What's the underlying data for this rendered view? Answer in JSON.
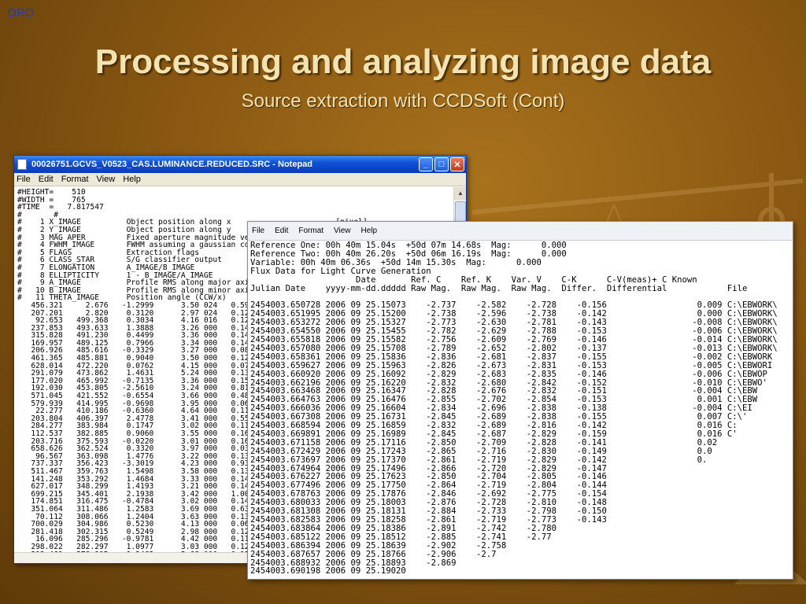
{
  "slide": {
    "corner_label": "DRO",
    "title": "Processing and analyzing image data",
    "subtitle": "Source extraction with CCDSoft (Cont)"
  },
  "notepad": {
    "title": "00026751.GCVS_V0523_CAS.LUMINANCE.REDUCED.SRC - Notepad",
    "menu": [
      "File",
      "Edit",
      "Format",
      "View",
      "Help"
    ],
    "buttons": {
      "minimize": "_",
      "maximize": "□",
      "close": "✕"
    },
    "lines": [
      "#HEIGHT=    510",
      "#WIDTH =    765",
      "#TIME  =   7.817547",
      "#       #",
      "#    1 X_IMAGE          Object position along x                       [pixel]",
      "#    2 Y_IMAGE          Object position along y",
      "#    3 MAG_APER         Fixed aperture magnitude vec",
      "#    4 FWHM_IMAGE       FWHM assuming a gaussian cor",
      "#    5 FLAGS            Extraction flags",
      "#    6 CLASS_STAR       S/G classifier output",
      "#    7 ELONGATION       A_IMAGE/B_IMAGE",
      "#    8 ELLIPTICITY      1 - B_IMAGE/A_IMAGE",
      "#    9 A_IMAGE          Profile RMS along major axis",
      "#   10 B_IMAGE          Profile RMS along minor axis",
      "#   11 THETA_IMAGE      Position angle (CCW/x)",
      "   456.321     2.676   -1.2999      3.50 024   0.59",
      "   207.201     2.820    0.3120      2.97 024   0.12",
      "    92.653   499.368    0.3034      4.16 016   0.12",
      "   237.853   493.633    1.3888      3.26 000   0.14",
      "   315.828   491.230    0.4499      3.36 000   0.14",
      "   169.957   489.125    0.7966      3.34 000   0.14",
      "   206.926   485.616   -0.3329      3.27 000   0.08",
      "   461.365   485.881    0.9040      3.50 000   0.12",
      "   628.014   472.220    0.0762      4.15 000   0.07",
      "   291.079   473.862    1.4631      5.24 000   0.13",
      "   177.020   465.992   -0.7135      3.36 000   0.15",
      "   192.030   453.805   -2.5610      3.24 000   0.81",
      "   571.045   421.552   -0.6554      3.66 000   0.48",
      "   579.939   414.995   -0.9698      3.95 000   0.06",
      "    22.277   410.186   -0.6360      4.64 000   0.11",
      "   203.804   406.397    2.4778      3.41 000   0.55",
      "   284.277   383.984    0.1747      3.02 000   0.11",
      "   112.537   382.885    0.9060      3.55 000   0.16",
      "   203.716   375.593   -0.0220      3.01 000   0.16",
      "   658.626   362.524    0.3320      3.97 000   0.03",
      "    96.567   363.098    1.4776      3.22 000   0.13",
      "   737.337   356.423   -3.3019      4.23 000   0.93",
      "   511.467   359.763    1.5498      3.58 000   0.13",
      "   141.248   353.292    1.4684      3.33 000   0.14",
      "   627.017   348.299    1.4193      3.21 000   0.14",
      "   699.215   345.401    2.1938      3.42 000   1.00",
      "   174.851   316.475   -0.4784      3.02 000   0.14",
      "   351.064   311.486    1.2583      3.69 000   0.63",
      "    70.112   308.066    1.2404      3.63 000   0.13",
      "   700.029   304.986    0.5230      4.13 000   0.06",
      "   281.418   302.315    0.5249      2.98 000   0.12",
      "    16.096   285.296   -0.9781      4.42 000   0.11",
      "   298.022   282.297    1.0977      3.03 000   0.12",
      "   313.461   278.995    1.3463      2.68 000   0.12"
    ]
  },
  "lightcurve": {
    "menu": [
      "File",
      "Edit",
      "Format",
      "View",
      "Help"
    ],
    "lines": [
      "Reference One: 00h 40m 15.04s  +50d 07m 14.68s  Mag:      0.000",
      "Reference Two: 00h 40m 26.20s  +50d 06m 16.19s  Mag:      0.000",
      "Variable: 00h 40m 06.36s  +50d 14m 15.30s  Mag:      0.000",
      "Flux Data for Light Curve Generation",
      "                     Date       Ref. C    Ref. K    Var. V    C-K      C-V(meas)+ C Known",
      "Julian Date    yyyy-mm-dd.ddddd Raw Mag.  Raw Mag.  Raw Mag.  Differ.  Differential            File",
      "",
      "2454003.650728 2006 09 25.15073    -2.737    -2.582    -2.728    -0.156                  0.009 C:\\EBWORK\\",
      "2454003.651995 2006 09 25.15200    -2.738    -2.596    -2.738    -0.142                  0.000 C:\\EBWORK\\",
      "2454003.653272 2006 09 25.15327    -2.773    -2.630    -2.781    -0.143                 -0.008 C:\\EBWORK\\",
      "2454003.654550 2006 09 25.15455    -2.782    -2.629    -2.788    -0.153                 -0.006 C:\\EBWORK\\",
      "2454003.655818 2006 09 25.15582    -2.756    -2.609    -2.769    -0.146                 -0.014 C:\\EBWORK\\",
      "2454003.657080 2006 09 25.15708    -2.789    -2.652    -2.802    -0.137                 -0.013 C:\\EBWORK\\",
      "2454003.658361 2006 09 25.15836    -2.836    -2.681    -2.837    -0.155                 -0.002 C:\\EBWORK",
      "2454003.659627 2006 09 25.15963    -2.826    -2.673    -2.831    -0.153                 -0.005 C:\\EBWORI",
      "2454003.660920 2006 09 25.16092    -2.829    -2.683    -2.835    -0.146                 -0.006 C:\\EBWOP",
      "2454003.662196 2006 09 25.16220    -2.832    -2.680    -2.842    -0.152                 -0.010 C:\\EBWO'",
      "2454003.663468 2006 09 25.16347    -2.828    -2.676    -2.832    -0.151                 -0.004 C:\\EBW",
      "2454003.664763 2006 09 25.16476    -2.855    -2.702    -2.854    -0.153                  0.001 C:\\EBW",
      "2454003.666036 2006 09 25.16604    -2.834    -2.696    -2.838    -0.138                 -0.004 C:\\EI",
      "2454003.667308 2006 09 25.16731    -2.845    -2.689    -2.838    -0.155                  0.007 C:\\'",
      "2454003.668594 2006 09 25.16859    -2.832    -2.689    -2.816    -0.142                  0.016 C:",
      "2454003.669891 2006 09 25.16989    -2.845    -2.687    -2.829    -0.159                  0.016 C'",
      "2454003.671158 2006 09 25.17116    -2.850    -2.709    -2.828    -0.141                  0.02",
      "2454003.672429 2006 09 25.17243    -2.865    -2.716    -2.830    -0.149                  0.0",
      "2454003.673697 2006 09 25.17370    -2.861    -2.719    -2.829    -0.142                  0.",
      "2454003.674964 2006 09 25.17496    -2.866    -2.720    -2.829    -0.147                  ",
      "2454003.676227 2006 09 25.17623    -2.850    -2.704    -2.805    -0.146",
      "2454003.677496 2006 09 25.17750    -2.864    -2.719    -2.804    -0.144",
      "2454003.678763 2006 09 25.17876    -2.846    -2.692    -2.775    -0.154",
      "2454003.680033 2006 09 25.18003    -2.876    -2.728    -2.810    -0.148",
      "2454003.681308 2006 09 25.18131    -2.884    -2.733    -2.798    -0.150",
      "2454003.682583 2006 09 25.18258    -2.861    -2.719    -2.773    -0.143",
      "2454003.683864 2006 09 25.18386    -2.891    -2.742    -2.780",
      "2454003.685122 2006 09 25.18512    -2.885    -2.741    -2.77",
      "2454003.686394 2006 09 25.18639    -2.902    -2.758",
      "2454003.687657 2006 09 25.18766    -2.906    -2.7",
      "2454003.688932 2006 09 25.18893    -2.869",
      "2454003.690198 2006 09 25.19020"
    ]
  }
}
